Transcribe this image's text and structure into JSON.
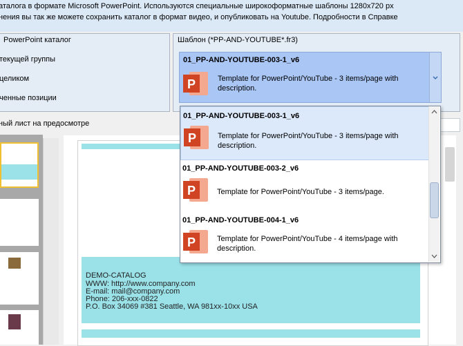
{
  "info": {
    "line1": "аталога в формате Microsoft PowerPoint. Используются специальные широкоформатные шаблоны 1280x720 px",
    "line2": "нения вы так же можете сохранить каталог в формат видео, и опубликовать на Youtube. Подробности в Справке"
  },
  "left_group": {
    "title": "PowerPoint каталог",
    "options": [
      "текущей группы",
      "целиком",
      "ченные позиции"
    ]
  },
  "preview_label": "ный лист на предосмотре",
  "template_group": {
    "title": "Шаблон (*PP-AND-YOUTUBE*.fr3)",
    "selected": {
      "name": "01_PP-AND-YOUTUBE-003-1_v6",
      "description": "Template for PowerPoint/YouTube - 3 items/page  with description."
    },
    "icon": "powerpoint-icon",
    "items": [
      {
        "name": "01_PP-AND-YOUTUBE-003-1_v6",
        "description": "Template for PowerPoint/YouTube - 3 items/page  with description."
      },
      {
        "name": "01_PP-AND-YOUTUBE-003-2_v6",
        "description": "Template for PowerPoint/YouTube - 3 items/page."
      },
      {
        "name": "01_PP-AND-YOUTUBE-004-1_v6",
        "description": "Template for PowerPoint/YouTube - 4 items/page  with description."
      }
    ]
  },
  "footer": {
    "company": "DEMO-CATALOG",
    "www": "WWW: http://www.company.com",
    "email": "E-mail: mail@company.com",
    "phone": "Phone: 206-xxx-0822",
    "address": "P.O. Box 34069 #381 Seattle, WA 981xx-10xx USA"
  },
  "colors": {
    "accent_cyan": "#9ae1e8",
    "powerpoint_red": "#d04423",
    "selection_blue": "#a9c6f5"
  }
}
